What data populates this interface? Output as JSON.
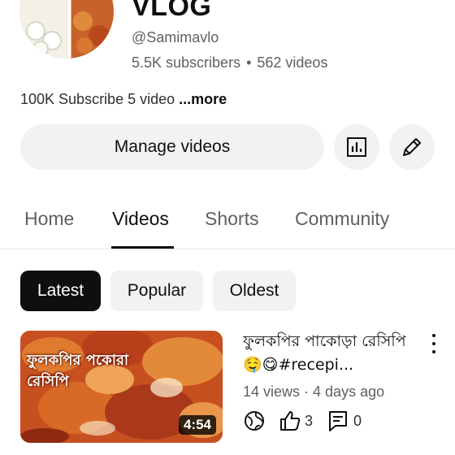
{
  "channel": {
    "name": "VLOG",
    "handle": "@Samimavlo",
    "subscribers": "5.5K subscribers",
    "dot": "•",
    "videos_count": "562 videos",
    "description": "100K Subscribe 5 video",
    "more_label": "...more"
  },
  "actions": {
    "manage_label": "Manage videos",
    "analytics_icon": "analytics-icon",
    "edit_icon": "pencil-icon"
  },
  "tabs": [
    {
      "label": "Home",
      "active": false
    },
    {
      "label": "Videos",
      "active": true
    },
    {
      "label": "Shorts",
      "active": false
    },
    {
      "label": "Community",
      "active": false
    }
  ],
  "chips": [
    {
      "label": "Latest",
      "selected": true
    },
    {
      "label": "Popular",
      "selected": false
    },
    {
      "label": "Oldest",
      "selected": false
    }
  ],
  "video": {
    "thumbnail_text": "ফুলকপির পকোরা রেসিপি",
    "duration": "4:54",
    "title": "ফুলকপির পাকোড়া রেসিপি 🤤😋#recepi...",
    "views": "14 views",
    "separator": "·",
    "age": "4 days ago",
    "likes": "3",
    "comments": "0",
    "visibility_icon": "globe-icon"
  },
  "colors": {
    "chip_selected_bg": "#0f0f0f",
    "button_bg": "#f2f2f2",
    "secondary_text": "#606060"
  }
}
